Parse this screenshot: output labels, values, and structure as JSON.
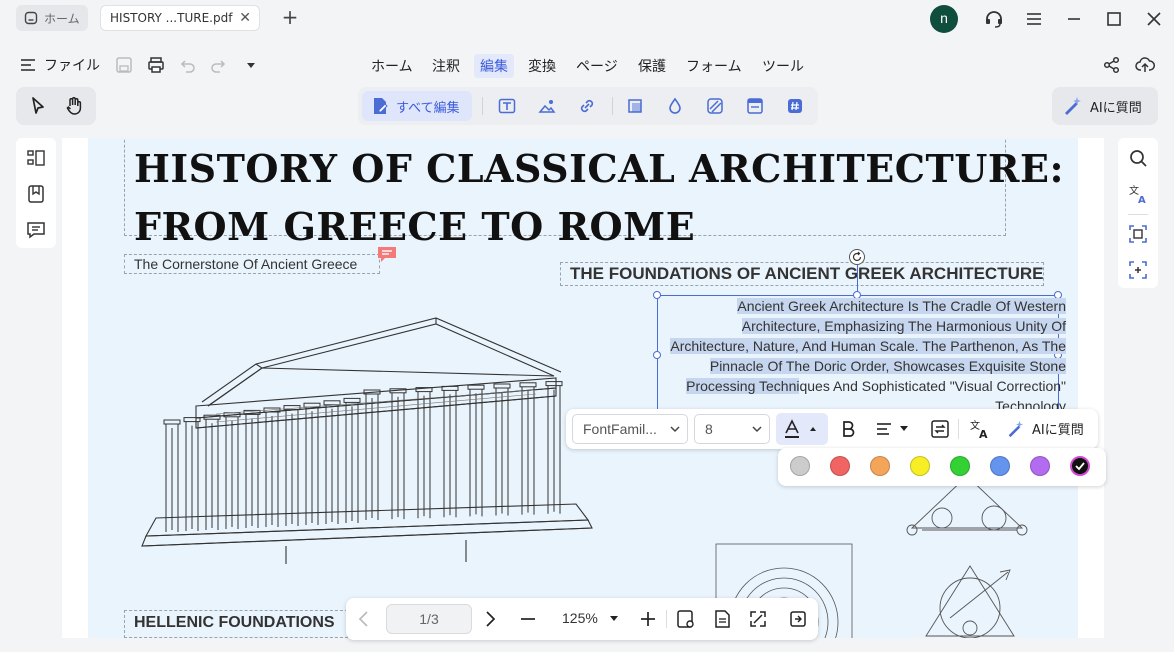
{
  "tabs": {
    "home": "ホーム",
    "document": "HISTORY ...TURE.pdf"
  },
  "user": {
    "avatar_initial": "n"
  },
  "menu": {
    "file": "ファイル",
    "items": [
      "ホーム",
      "注釈",
      "編集",
      "変換",
      "ページ",
      "保護",
      "フォーム",
      "ツール"
    ],
    "active": "編集"
  },
  "toolbar": {
    "edit_all": "すべて編集",
    "ai_question": "AIに質問"
  },
  "document": {
    "title_line1": "HISTORY OF CLASSICAL  ARCHITECTURE:",
    "title_line2": "FROM GREECE TO ROME",
    "subtitle": "The Cornerstone Of Ancient Greece",
    "section_heading": "THE FOUNDATIONS OF ANCIENT GREEK ARCHITECTURE",
    "body_highlighted": "Ancient Greek Architecture Is The Cradle Of Western Architecture, Emphasizing The Harmonious Unity Of Architecture, Nature, And Human Scale. The Parthenon, As The Pinnacle Of The Doric Order, Showcases Exquisite Stone Processing Techni",
    "body_rest": "ques And Sophisticated \"Visual Correction\" Technology",
    "section_heading_2": "HELLENIC FOUNDATIONS"
  },
  "format_toolbar": {
    "font_family": "FontFamil...",
    "font_size": "8",
    "ai_question": "AIに質問"
  },
  "colors": [
    "#cccccc",
    "#f06464",
    "#f5a55a",
    "#f7ee25",
    "#34d134",
    "#6494ee",
    "#b36bf0",
    "#111111"
  ],
  "navigation": {
    "page": "1/3",
    "zoom": "125%"
  }
}
